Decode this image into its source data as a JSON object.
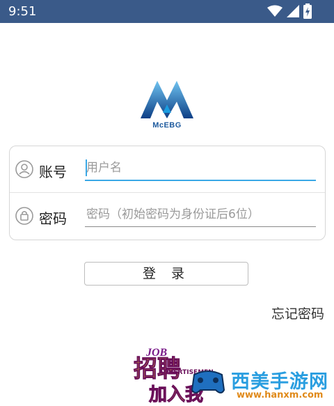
{
  "status_bar": {
    "time": "9:51",
    "icons": [
      "wifi-icon",
      "signal-icon",
      "battery-charging-icon"
    ]
  },
  "logo": {
    "text": "McEBG"
  },
  "form": {
    "username": {
      "label": "账号",
      "placeholder": "用户名",
      "value": ""
    },
    "password": {
      "label": "密码",
      "placeholder": "密码（初始密码为身份证后6位）",
      "value": ""
    }
  },
  "login_button": {
    "label": "登 录"
  },
  "forgot_link": {
    "label": "忘记密码"
  },
  "watermark": {
    "job": "JOB",
    "title": "招聘",
    "ad": "ADVERTISEMEN",
    "join": "加入我",
    "site": "西美手游网",
    "url": "www.hanxm.com"
  },
  "colors": {
    "status_bar": "#3a5a89",
    "accent": "#3aa8e6",
    "logo": "#1d5a9e"
  }
}
